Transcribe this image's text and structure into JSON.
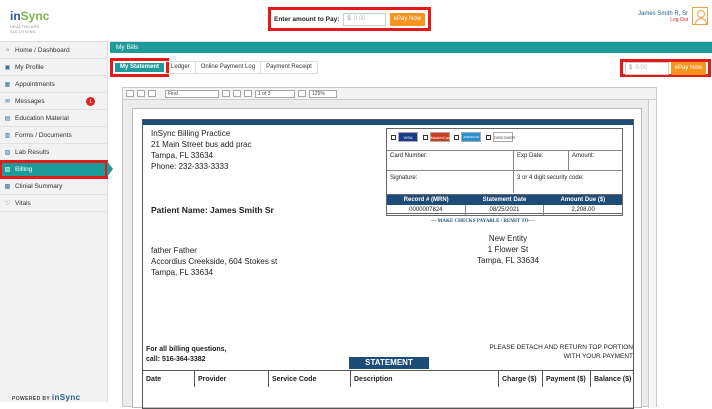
{
  "header": {
    "logo": {
      "prefix": "in",
      "brand": "Sync",
      "tagline": "HEALTHCARE SOLUTIONS"
    },
    "payment": {
      "label": "Enter amount to Pay:",
      "currency": "$",
      "placeholder": "0.00",
      "button": "ePay Now"
    },
    "user": {
      "name": "James Smith R, Sr",
      "logout": "Log Out"
    }
  },
  "sidebar": {
    "items": [
      {
        "label": "Home / Dashboard",
        "icon": "home-icon"
      },
      {
        "label": "My Profile",
        "icon": "user-icon"
      },
      {
        "label": "Appointments",
        "icon": "calendar-icon"
      },
      {
        "label": "Messages",
        "icon": "mail-icon",
        "badge": "1"
      },
      {
        "label": "Education Material",
        "icon": "book-icon"
      },
      {
        "label": "Forms / Documents",
        "icon": "document-icon"
      },
      {
        "label": "Lab Results",
        "icon": "chart-icon"
      },
      {
        "label": "Billing",
        "icon": "billing-icon"
      },
      {
        "label": "Clinial Summary",
        "icon": "summary-icon"
      },
      {
        "label": "Vitals",
        "icon": "heart-icon"
      }
    ],
    "footer": {
      "powered_by": "POWERED BY",
      "brand": "inSync"
    }
  },
  "main": {
    "title": "My Bills",
    "tabs": [
      "My Statement",
      "Ledger",
      "Online Payment Log",
      "Payment Receipt"
    ],
    "payment": {
      "currency": "$",
      "placeholder": "0.00",
      "button": "ePay Now"
    }
  },
  "viewer": {
    "find": "Find",
    "page": "1",
    "pages": "of 3",
    "zoom": "125%"
  },
  "statement": {
    "practice": {
      "name": "InSync Billing Practice",
      "address1": "21 Main Street bus add prac",
      "address2": "Tampa, FL 33634",
      "phone": "Phone: 232-333-3333"
    },
    "cards": {
      "visa": "VISA",
      "mastercard": "MasterCard",
      "amex": "AMERICAN EXPRESS",
      "discover": "DISCOVER"
    },
    "card_fields": {
      "number": "Card Number:",
      "exp": "Exp Date:",
      "amount": "Amount:",
      "signature": "Signature:",
      "cvv": "3 or 4 digit security code:"
    },
    "record_table": {
      "headers": [
        "Record # (MRN)",
        "Statement Date",
        "Amount Due ($)"
      ],
      "values": [
        "0000007824",
        "08/25/2021",
        "2,208.00"
      ]
    },
    "checks_payable": "----MAKE CHECKS PAYABLE / REMIT TO----",
    "patient": "Patient Name: James Smith Sr",
    "guarantor": {
      "name": "father Father",
      "address1": "Accordius Creekside, 604 Stokes st",
      "address2": "Tampa, FL 33634"
    },
    "remit": {
      "name": "New Entity",
      "address1": "1 Flower St",
      "address2": "Tampa, FL 33634"
    },
    "billing_questions": "For all billing questions,",
    "billing_call": "call: 516-364-3382",
    "detach": "PLEASE DETACH AND RETURN TOP PORTION",
    "detach2": "WITH YOUR PAYMENT",
    "section": "STATEMENT",
    "columns": [
      "Date",
      "Provider",
      "Service Code",
      "Description",
      "Charge ($)",
      "Payment ($)",
      "Balance ($)"
    ]
  },
  "colors": {
    "accent": "#1d9a9a",
    "navy": "#1e4c78",
    "orange": "#f7941d",
    "highlight": "#e41919"
  }
}
